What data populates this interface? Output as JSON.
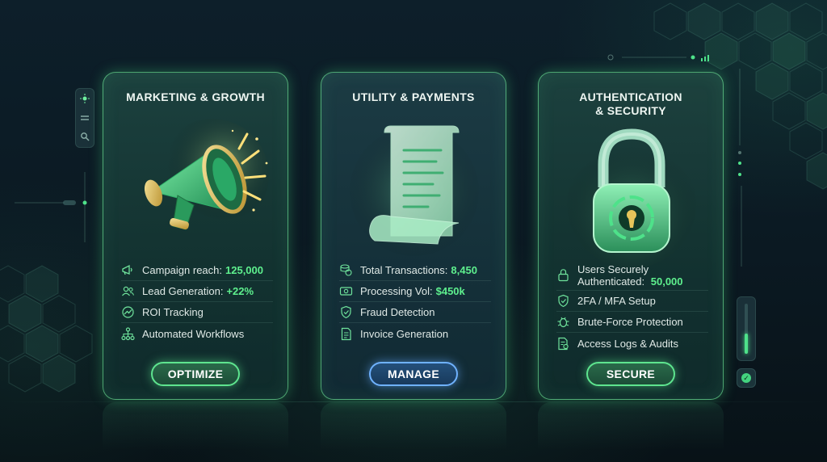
{
  "cards": [
    {
      "title": "MARKETING & GROWTH",
      "title_line2": "",
      "illustration": "megaphone-illustration",
      "features": [
        {
          "icon": "megaphone-icon",
          "label": "Campaign reach:",
          "value": "125,000"
        },
        {
          "icon": "users-icon",
          "label": "Lead Generation:",
          "value": "+22%"
        },
        {
          "icon": "trend-icon",
          "label": "ROI Tracking",
          "value": ""
        },
        {
          "icon": "workflow-icon",
          "label": "Automated Workflows",
          "value": ""
        }
      ],
      "button": "OPTIMIZE"
    },
    {
      "title": "UTILITY & PAYMENTS",
      "title_line2": "",
      "illustration": "receipt-illustration",
      "features": [
        {
          "icon": "coins-icon",
          "label": "Total Transactions:",
          "value": "8,450"
        },
        {
          "icon": "cash-icon",
          "label": "Processing Vol:",
          "value": "$450k"
        },
        {
          "icon": "shield-icon",
          "label": "Fraud Detection",
          "value": ""
        },
        {
          "icon": "invoice-icon",
          "label": "Invoice Generation",
          "value": ""
        }
      ],
      "button": "MANAGE"
    },
    {
      "title": "AUTHENTICATION",
      "title_line2": "& SECURITY",
      "illustration": "padlock-illustration",
      "features": [
        {
          "icon": "lock-icon",
          "label": "Users Securely Authenticated:",
          "value": "50,000"
        },
        {
          "icon": "shield-check-icon",
          "label": "2FA / MFA Setup",
          "value": ""
        },
        {
          "icon": "bug-icon",
          "label": "Brute-Force Protection",
          "value": ""
        },
        {
          "icon": "log-icon",
          "label": "Access Logs & Audits",
          "value": ""
        }
      ],
      "button": "SECURE"
    }
  ],
  "side_controls": {
    "left_rail": [
      "sun-icon",
      "menu-icon",
      "search-icon"
    ],
    "right_slider_level": 0.4,
    "status_icon": "check-icon"
  },
  "colors": {
    "accent_green": "#5ef08e",
    "button_green": "#5ee58f",
    "button_blue": "#6fb2ff",
    "background": "#0b1a22"
  }
}
